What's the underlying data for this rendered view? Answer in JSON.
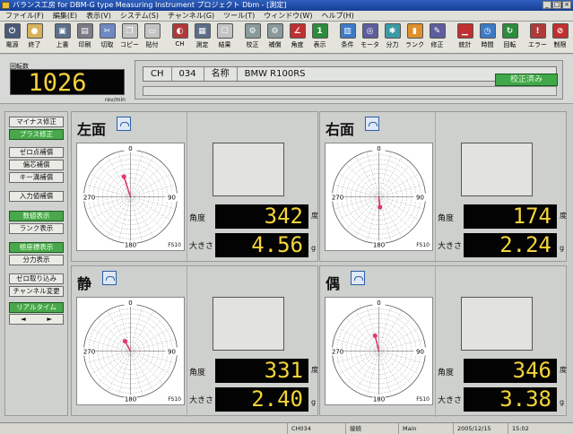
{
  "window": {
    "title": "バランス工房 for DBM-G type Measuring Instrument プロジェクト Dbm - [測定]"
  },
  "menu": [
    "ファイル(F)",
    "編集(E)",
    "表示(V)",
    "システム(S)",
    "チャンネル(G)",
    "ツール(T)",
    "ウィンドウ(W)",
    "ヘルプ(H)"
  ],
  "toolbar": [
    {
      "label": "電源",
      "icon": "power-icon"
    },
    {
      "label": "終了",
      "icon": "exit-icon"
    },
    {
      "label": "上書",
      "icon": "save-icon"
    },
    {
      "label": "印刷",
      "icon": "print-icon"
    },
    {
      "label": "切取",
      "icon": "cut-icon"
    },
    {
      "label": "コピー",
      "icon": "copy-icon"
    },
    {
      "label": "貼付",
      "icon": "paste-icon"
    },
    {
      "label": "CH",
      "icon": "channel-icon"
    },
    {
      "label": "測定",
      "icon": "measure-icon"
    },
    {
      "label": "結果",
      "icon": "result-icon"
    },
    {
      "label": "校正",
      "icon": "calibrate-icon"
    },
    {
      "label": "補償",
      "icon": "compensate-icon"
    },
    {
      "label": "角度",
      "icon": "angle-icon"
    },
    {
      "label": "表示",
      "icon": "display-icon"
    },
    {
      "label": "条件",
      "icon": "condition-icon"
    },
    {
      "label": "モータ",
      "icon": "motor-icon"
    },
    {
      "label": "分力",
      "icon": "component-icon"
    },
    {
      "label": "ランク",
      "icon": "rank-icon"
    },
    {
      "label": "修正",
      "icon": "correction-icon"
    },
    {
      "label": "統計",
      "icon": "statistics-icon"
    },
    {
      "label": "時間",
      "icon": "time-icon"
    },
    {
      "label": "回転",
      "icon": "rotation-icon"
    },
    {
      "label": "エラー",
      "icon": "error-icon"
    },
    {
      "label": "制限",
      "icon": "limit-icon"
    }
  ],
  "rpm": {
    "label": "回転数",
    "value": "1026",
    "unit": "rev/min"
  },
  "info": {
    "ch_label": "CH",
    "ch_value": "034",
    "name_label": "名称",
    "name_value": "BMW R100RS",
    "calibrated": "校正済み"
  },
  "sidebar": [
    {
      "label": "マイナス修正",
      "on": false
    },
    {
      "label": "プラス修正",
      "on": true
    },
    {
      "label": "ゼロ点補償",
      "on": false
    },
    {
      "label": "偏芯補償",
      "on": false
    },
    {
      "label": "キー溝補償",
      "on": false
    },
    {
      "label": "入力値補償",
      "on": false
    },
    {
      "label": "数値表示",
      "on": true
    },
    {
      "label": "ランク表示",
      "on": false
    },
    {
      "label": "極座標表示",
      "on": true
    },
    {
      "label": "分力表示",
      "on": false
    },
    {
      "label": "ゼロ取り込み",
      "on": false
    },
    {
      "label": "チャンネル変更",
      "on": false
    },
    {
      "label": "リアルタイム",
      "on": true
    }
  ],
  "arrows": {
    "left": "◄",
    "right": "►"
  },
  "panels": [
    {
      "title": "左面",
      "angle": "342",
      "magnitude": "4.56",
      "angle_label": "角度",
      "mag_label": "大きさ",
      "angle_unit": "度",
      "mag_unit": "g",
      "fs": "FS10",
      "ticks": [
        "0",
        "90",
        "180",
        "270"
      ]
    },
    {
      "title": "右面",
      "angle": "174",
      "magnitude": "2.24",
      "angle_label": "角度",
      "mag_label": "大きさ",
      "angle_unit": "度",
      "mag_unit": "g",
      "fs": "FS10",
      "ticks": [
        "0",
        "90",
        "180",
        "270"
      ]
    },
    {
      "title": "静",
      "angle": "331",
      "magnitude": "2.40",
      "angle_label": "角度",
      "mag_label": "大きさ",
      "angle_unit": "度",
      "mag_unit": "g",
      "fs": "FS10",
      "ticks": [
        "0",
        "90",
        "180",
        "270"
      ]
    },
    {
      "title": "偶",
      "angle": "346",
      "magnitude": "3.38",
      "angle_label": "角度",
      "mag_label": "大きさ",
      "angle_unit": "度",
      "mag_unit": "g",
      "fs": "FS10",
      "ticks": [
        "0",
        "90",
        "180",
        "270"
      ]
    }
  ],
  "status": {
    "channel": "CH034",
    "conn": "接続",
    "mode": "Main",
    "date": "2005/12/15",
    "time": "15:02"
  },
  "colors": {
    "display_bg": "#030303",
    "display_fg": "#f5d43b",
    "active_green": "#49a84b",
    "vector": "#e03a6a"
  }
}
